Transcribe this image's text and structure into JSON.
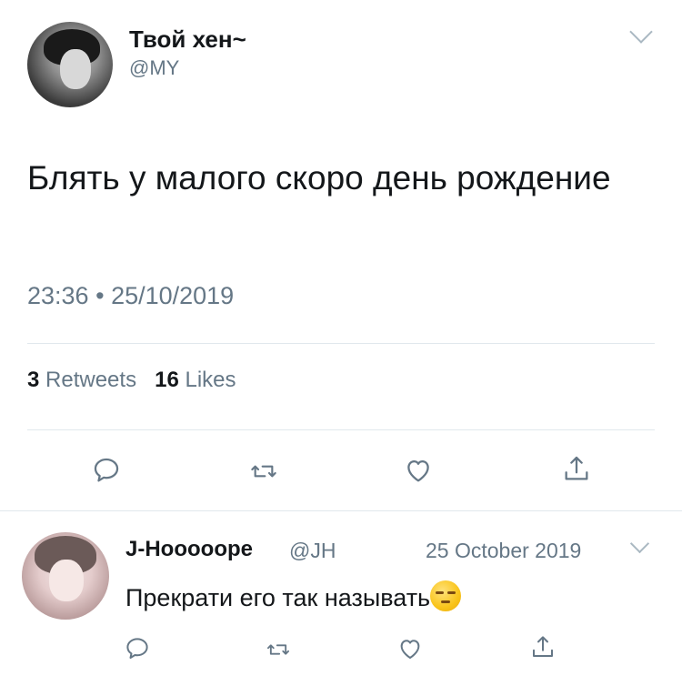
{
  "tweet": {
    "display_name": "Твой хен~",
    "handle": "@MY",
    "text": "Блять у малого скоро день рождение",
    "time": "23:36",
    "separator": "•",
    "date": "25/10/2019",
    "retweets_count": "3",
    "retweets_label": "Retweets",
    "likes_count": "16",
    "likes_label": "Likes"
  },
  "reply": {
    "display_name": "J-Hoooоope",
    "handle": "@JH",
    "date": "25 October 2019",
    "text": "Прекрати его так называть"
  },
  "icons": {
    "reply": "reply-icon",
    "retweet": "retweet-icon",
    "like": "heart-icon",
    "share": "share-icon",
    "menu": "chevron-down-icon",
    "emoji": "unamused-face-emoji"
  },
  "colors": {
    "text": "#14171a",
    "secondary": "#657786",
    "icon": "#657786",
    "divider": "#e1e8ed"
  }
}
